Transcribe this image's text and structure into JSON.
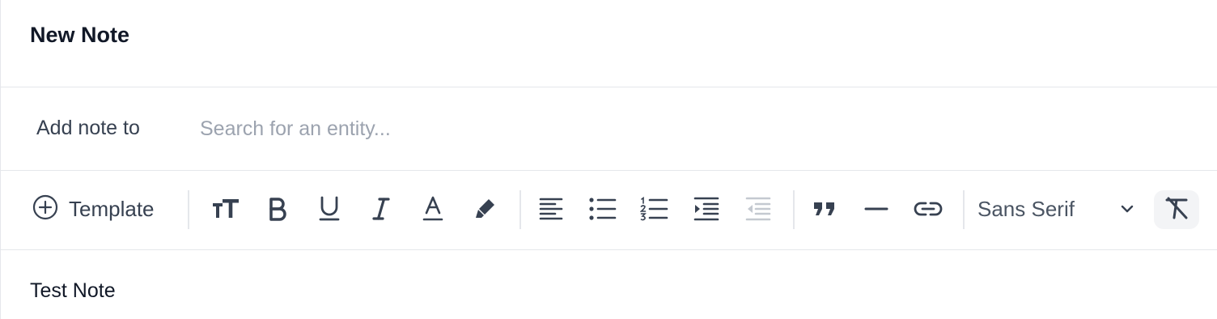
{
  "header": {
    "title": "New Note"
  },
  "entity": {
    "label": "Add note to",
    "placeholder": "Search for an entity...",
    "value": ""
  },
  "toolbar": {
    "template_label": "Template",
    "font_family_value": "Sans Serif",
    "buttons": [
      "font-size-icon",
      "bold-icon",
      "underline-icon",
      "italic-icon",
      "text-color-icon",
      "highlight-icon",
      "align-left-icon",
      "bullet-list-icon",
      "numbered-list-icon",
      "indent-icon",
      "outdent-icon",
      "blockquote-icon",
      "horizontal-rule-icon",
      "link-icon",
      "chevron-down-icon",
      "clear-format-icon"
    ]
  },
  "editor": {
    "content": "Test Note"
  },
  "colors": {
    "icon": "#374151",
    "icon_disabled": "#9ca3af",
    "border": "#e5e7eb",
    "clear_button_bg": "#f3f4f6"
  }
}
